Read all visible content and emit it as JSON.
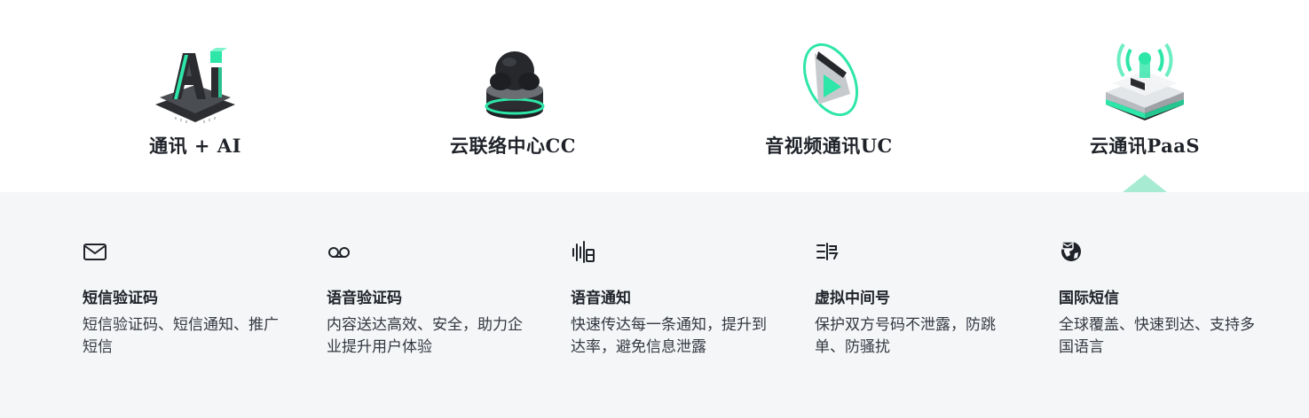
{
  "tabs": [
    {
      "label": "通讯 + AI",
      "icon": "ai-chip-icon"
    },
    {
      "label": "云联络中心CC",
      "icon": "contact-center-headset-icon"
    },
    {
      "label": "音视频通讯UC",
      "icon": "video-play-icon"
    },
    {
      "label": "云通讯PaaS",
      "icon": "signal-tower-icon",
      "active": true
    }
  ],
  "colors": {
    "accent": "#2ee6a8",
    "pointer": "#a8ebd3",
    "panel_bg": "#f5f6f8",
    "text": "#1f2329"
  },
  "products": [
    {
      "icon": "mail-icon",
      "title": "短信验证码",
      "desc": "短信验证码、短信通知、推广短信"
    },
    {
      "icon": "voicemail-icon",
      "title": "语音验证码",
      "desc": "内容送达高效、安全，助力企业提升用户体验"
    },
    {
      "icon": "sound-wave-icon",
      "title": "语音通知",
      "desc": "快速传达每一条通知，提升到达率，避免信息泄露"
    },
    {
      "icon": "virtual-number-icon",
      "title": "虚拟中间号",
      "desc": "保护双方号码不泄露，防跳单、防骚扰"
    },
    {
      "icon": "global-message-icon",
      "title": "国际短信",
      "desc": "全球覆盖、快速到达、支持多国语言"
    }
  ]
}
